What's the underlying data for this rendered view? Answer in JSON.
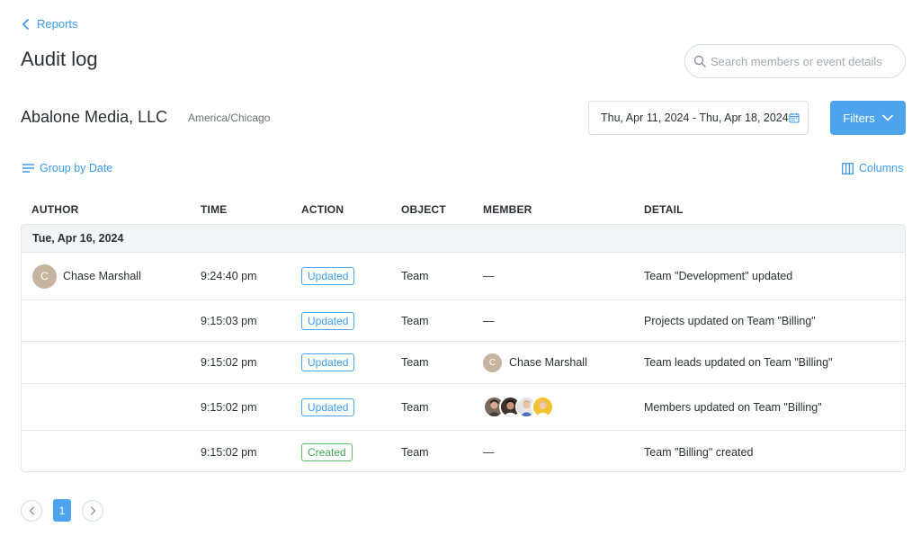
{
  "nav": {
    "back_label": "Reports"
  },
  "header": {
    "title": "Audit log",
    "search_placeholder": "Search members or event details"
  },
  "org": {
    "name": "Abalone Media, LLC",
    "timezone": "America/Chicago",
    "date_range": "Thu, Apr 11, 2024 - Thu, Apr 18, 2024",
    "filters_label": "Filters"
  },
  "toolbar": {
    "group_by_label": "Group by Date",
    "columns_label": "Columns"
  },
  "table": {
    "headers": [
      "AUTHOR",
      "TIME",
      "ACTION",
      "OBJECT",
      "MEMBER",
      "DETAIL"
    ],
    "group_label": "Tue, Apr 16, 2024",
    "rows": [
      {
        "author": "Chase Marshall",
        "author_initial": "C",
        "time": "9:24:40 pm",
        "action": "Updated",
        "object": "Team",
        "member": "—",
        "detail": "Team \"Development\" updated"
      },
      {
        "author": "",
        "time": "9:15:03 pm",
        "action": "Updated",
        "object": "Team",
        "member": "—",
        "detail": "Projects updated on Team \"Billing\""
      },
      {
        "author": "",
        "time": "9:15:02 pm",
        "action": "Updated",
        "object": "Team",
        "member": "Chase Marshall",
        "member_initial": "C",
        "detail": "Team leads updated on Team \"Billing\""
      },
      {
        "author": "",
        "time": "9:15:02 pm",
        "action": "Updated",
        "object": "Team",
        "member": "",
        "detail": "Members updated on Team \"Billing\""
      },
      {
        "author": "",
        "time": "9:15:02 pm",
        "action": "Created",
        "object": "Team",
        "member": "—",
        "detail": "Team \"Billing\" created"
      }
    ]
  },
  "pagination": {
    "current_page": "1"
  },
  "colors": {
    "accent": "#4ea4ec",
    "created": "#44a854",
    "avatar": "#c7b49f"
  }
}
